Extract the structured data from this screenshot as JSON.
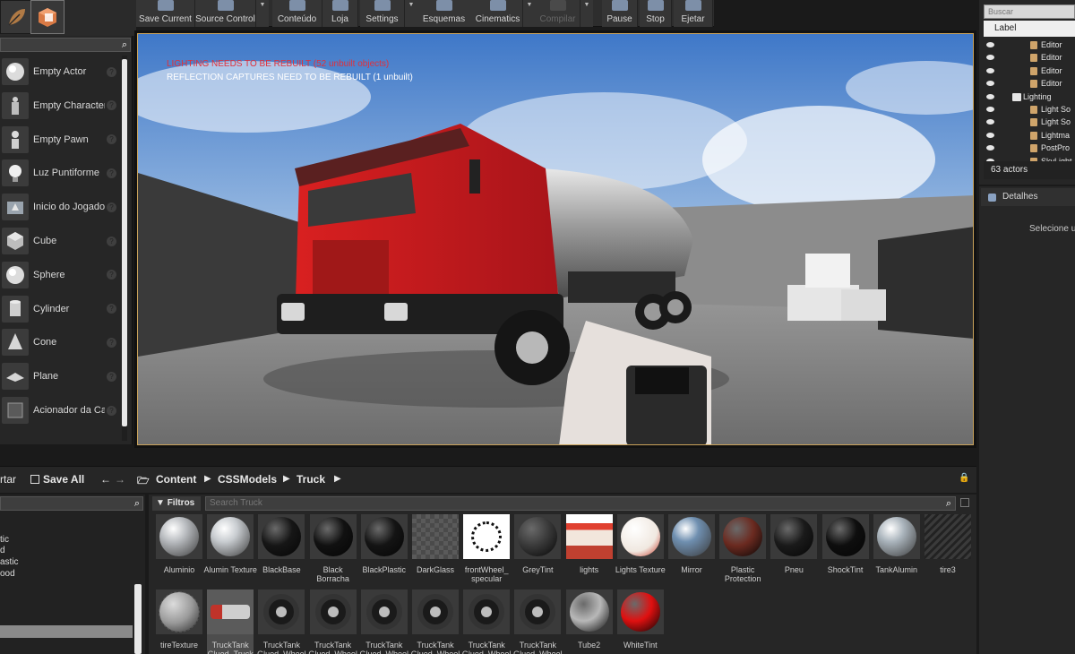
{
  "toolbar": {
    "buttons": [
      {
        "label": "Save Current",
        "disabled": false
      },
      {
        "label": "Source Control",
        "disabled": false
      },
      {
        "label": "Conteúdo",
        "disabled": false
      },
      {
        "label": "Loja",
        "disabled": false
      },
      {
        "label": "Settings",
        "disabled": false
      },
      {
        "label": "Esquemas",
        "disabled": false
      },
      {
        "label": "Cinematics",
        "disabled": false
      },
      {
        "label": "Compilar",
        "disabled": true
      },
      {
        "label": "Pause",
        "disabled": false
      },
      {
        "label": "Stop",
        "disabled": false
      },
      {
        "label": "Ejetar",
        "disabled": false
      }
    ]
  },
  "place": {
    "items": [
      {
        "label": "Empty Actor",
        "icon": "sphere-icon"
      },
      {
        "label": "Empty Character",
        "icon": "character-icon"
      },
      {
        "label": "Empty Pawn",
        "icon": "pawn-icon"
      },
      {
        "label": "Luz Puntiforme",
        "icon": "bulb-icon"
      },
      {
        "label": "Inicio do Jogador",
        "icon": "player-start-icon"
      },
      {
        "label": "Cube",
        "icon": "cube-icon"
      },
      {
        "label": "Sphere",
        "icon": "sphere-icon"
      },
      {
        "label": "Cylinder",
        "icon": "cylinder-icon"
      },
      {
        "label": "Cone",
        "icon": "cone-icon"
      },
      {
        "label": "Plane",
        "icon": "plane-icon"
      },
      {
        "label": "Acionador da Cai",
        "icon": "box-trigger-icon"
      }
    ]
  },
  "viewport": {
    "warning": "LIGHTING NEEDS TO BE REBUILT (52 unbuilt objects)",
    "info": "REFLECTION CAPTURES NEED TO BE REBUILT (1 unbuilt)"
  },
  "outliner": {
    "search_placeholder": "Buscar",
    "column_label": "Label",
    "rows": [
      {
        "label": "Editor",
        "indent": 2
      },
      {
        "label": "Editor",
        "indent": 2
      },
      {
        "label": "Editor",
        "indent": 2
      },
      {
        "label": "Editor",
        "indent": 2
      },
      {
        "label": "Lighting",
        "indent": 1
      },
      {
        "label": "Light So",
        "indent": 2
      },
      {
        "label": "Light So",
        "indent": 2
      },
      {
        "label": "Lightma",
        "indent": 2
      },
      {
        "label": "PostPro",
        "indent": 2
      },
      {
        "label": "SkyLight",
        "indent": 2
      }
    ],
    "count": "63 actors"
  },
  "details": {
    "tab": "Detalhes",
    "empty_text": "Selecione u"
  },
  "content_browser": {
    "import_label": "rtar",
    "save_all_label": "Save All",
    "path": [
      "Content",
      "CSSModels",
      "Truck"
    ],
    "filters_label": "Filtros",
    "search_placeholder": "Search Truck",
    "sources": [
      "tic",
      "d",
      "astic",
      "ood"
    ],
    "assets_row1": [
      {
        "name": "Aluminio",
        "color": "#b9bcc0",
        "kind": "metal"
      },
      {
        "name": "Alumin Texture",
        "color": "#c8ccd0",
        "kind": "metal"
      },
      {
        "name": "BlackBase",
        "color": "#161616",
        "kind": "ball"
      },
      {
        "name": "Black Borracha",
        "color": "#111111",
        "kind": "ball"
      },
      {
        "name": "BlackPlastic",
        "color": "#141414",
        "kind": "ball"
      },
      {
        "name": "DarkGlass",
        "color": "#4a4a4a",
        "kind": "checker"
      },
      {
        "name": "frontWheel_ specular",
        "color": "#ffffff",
        "kind": "dots"
      },
      {
        "name": "GreyTint",
        "color": "#3a3a3a",
        "kind": "ball"
      },
      {
        "name": "lights",
        "color": "#e04030",
        "kind": "texture"
      },
      {
        "name": "Lights Texture",
        "color": "#f0e8e0",
        "kind": "lights"
      },
      {
        "name": "Mirror",
        "color": "#6f8fb0",
        "kind": "metal"
      },
      {
        "name": "Plastic Protection",
        "color": "#6b2a20",
        "kind": "ball"
      },
      {
        "name": "Pneu",
        "color": "#1a1a1a",
        "kind": "ball"
      },
      {
        "name": "ShockTint",
        "color": "#0e0e0e",
        "kind": "ball"
      },
      {
        "name": "TankAlumin",
        "color": "#aab4bc",
        "kind": "metal"
      },
      {
        "name": "tire3",
        "color": "#2a2a2a",
        "kind": "tread"
      }
    ],
    "assets_row2": [
      {
        "name": "tireTexture",
        "color": "#9a9a9a",
        "kind": "tread-ball"
      },
      {
        "name": "TruckTank Glued_Truck",
        "color": "#c0332a",
        "kind": "truck",
        "selected": true
      },
      {
        "name": "TruckTank Glued_Wheel",
        "color": "#1a1a1a",
        "kind": "wheel"
      },
      {
        "name": "TruckTank Glued_Wheel",
        "color": "#1a1a1a",
        "kind": "wheel"
      },
      {
        "name": "TruckTank Glued_Wheel",
        "color": "#1a1a1a",
        "kind": "wheel"
      },
      {
        "name": "TruckTank Glued_Wheel",
        "color": "#1a1a1a",
        "kind": "wheel"
      },
      {
        "name": "TruckTank Glued_Wheel",
        "color": "#1a1a1a",
        "kind": "wheel"
      },
      {
        "name": "TruckTank Glued_Wheel",
        "color": "#1a1a1a",
        "kind": "wheel"
      },
      {
        "name": "Tube2",
        "color": "#b8b8b8",
        "kind": "ball"
      },
      {
        "name": "WhiteTint",
        "color": "#e01010",
        "kind": "ball"
      }
    ]
  }
}
